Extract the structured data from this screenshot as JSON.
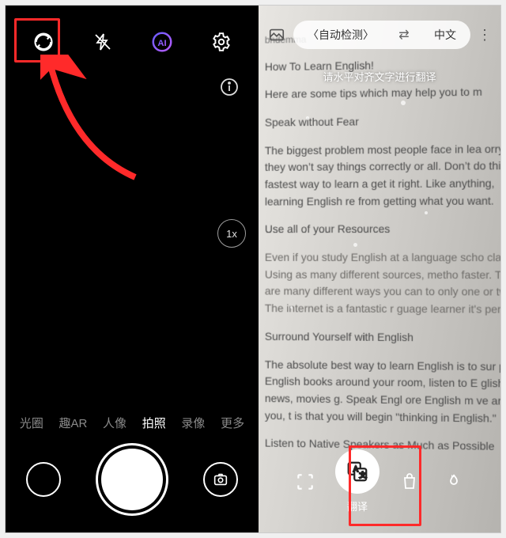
{
  "left": {
    "top_icons": {
      "lens": "lens-icon",
      "flash": "flash-off-icon",
      "ai": "ai-icon",
      "settings": "settings-icon"
    },
    "zoom_label": "1x",
    "modes": [
      "光圈",
      "趣AR",
      "人像",
      "拍照",
      "录像",
      "更多"
    ],
    "active_mode_index": 3
  },
  "right": {
    "username": "bndemma",
    "lang_from": "〈自动检测〉",
    "lang_to": "中文",
    "swap_symbol": "⇄",
    "hint": "请水平对齐文字进行翻译",
    "translate_label": "翻译",
    "doc_lines": [
      "How To Learn English!",
      "Here are some tips which may help you to m",
      "Speak without Fear",
      "The biggest problem most people face in lea orry that they won’t say things correctly or all. Don’t do this. The fastest way to learn a get it right. Like anything, learning English re from getting what you want.",
      "Use all of your Resources",
      "Even if you study English at a language scho class. Using as many different sources, metho faster. There are many different ways you can to only one or two. The internet is a fantastic r guage learner it's perfect.",
      "Surround Yourself with English",
      "The absolute best way to learn English is to sur put English books around your room, listen to E glish news, movies                     g. Speak Engl ore English m                             ve around you, t is that you will begin   \"thinking in English.\"",
      "Listen to Native Speakers as Much as Possible"
    ]
  }
}
